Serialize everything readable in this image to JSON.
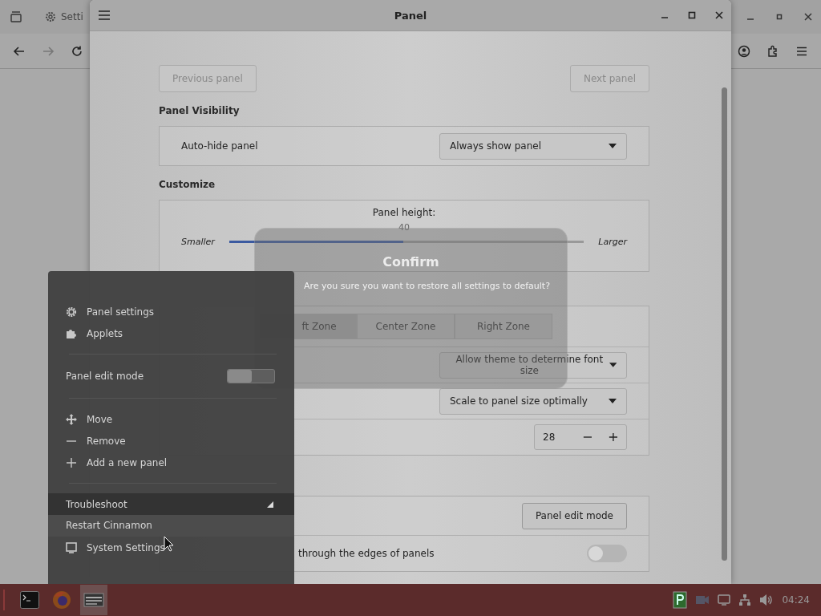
{
  "browser": {
    "tab_label": "Setti"
  },
  "window": {
    "title": "Panel"
  },
  "nav_buttons": [
    {
      "label": "Previous panel",
      "disabled": true
    },
    {
      "label": "Next panel",
      "disabled": true
    }
  ],
  "sections": [
    {
      "heading": "Panel Visibility",
      "rows": [
        {
          "kind": "dropdown",
          "label": "Auto-hide panel",
          "value": "Always show panel"
        }
      ]
    },
    {
      "heading": "Customize",
      "rows": [
        {
          "kind": "slider",
          "label": "Panel height:",
          "reading": "40",
          "min_label": "Smaller",
          "max_label": "Larger",
          "level": 0.49
        }
      ]
    },
    {
      "zones": [
        {
          "label": "ft Zone",
          "selected": true
        },
        {
          "label": "Center Zone",
          "selected": false
        },
        {
          "label": "Right Zone",
          "selected": false
        }
      ],
      "rows": [
        {
          "kind": "dropdown",
          "value": "Allow theme to determine font size"
        },
        {
          "kind": "dropdown",
          "value": "Scale to panel size optimally"
        },
        {
          "kind": "spin",
          "value": "28"
        }
      ]
    },
    {
      "rows": [
        {
          "kind": "button",
          "button": "Panel edit mode"
        },
        {
          "kind": "switch",
          "label": "through the edges of panels",
          "on": false
        }
      ]
    }
  ],
  "confirm": {
    "title": "Confirm",
    "message": "Are you sure you want to restore all settings to default?"
  },
  "context_menu": [
    {
      "kind": "item",
      "label": "Panel settings",
      "selected": false
    },
    {
      "kind": "item",
      "label": "Applets",
      "selected": false
    },
    {
      "kind": "separator"
    },
    {
      "kind": "switch",
      "label": "Panel edit mode",
      "on": false
    },
    {
      "kind": "separator"
    },
    {
      "kind": "item",
      "label": "Move",
      "selected": false
    },
    {
      "kind": "item",
      "label": "Remove",
      "selected": false
    },
    {
      "kind": "item",
      "label": "Add a new panel",
      "selected": false
    },
    {
      "kind": "separator"
    },
    {
      "kind": "submenu",
      "label": "Troubleshoot",
      "expanded": true,
      "selected": true
    },
    {
      "kind": "subitem",
      "label": "Restart Cinnamon",
      "selected": false
    },
    {
      "kind": "item",
      "label": "System Settings",
      "selected": false
    }
  ],
  "taskbar": {
    "apps": [
      {
        "kind": "terminal",
        "selected": false
      },
      {
        "kind": "browser",
        "selected": false
      },
      {
        "kind": "files",
        "selected": true
      }
    ],
    "clock": "04:24"
  }
}
